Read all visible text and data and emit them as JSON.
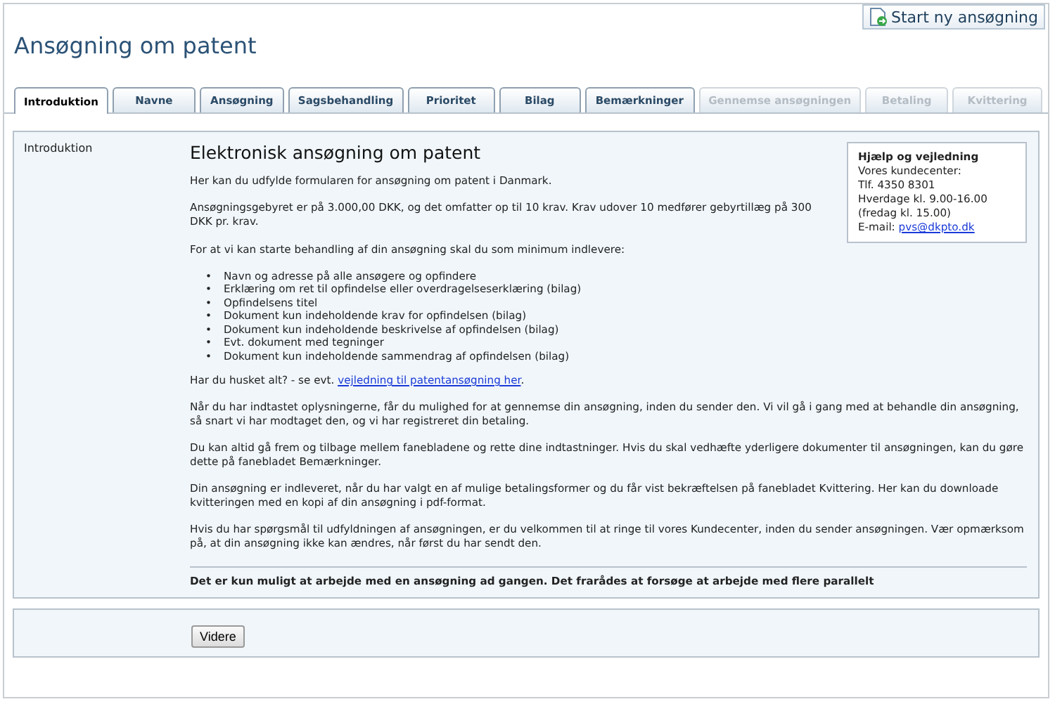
{
  "header": {
    "new_button": "Start ny ansøgning",
    "title": "Ansøgning om patent"
  },
  "tabs": [
    {
      "label": "Introduktion",
      "selected": true,
      "disabled": false
    },
    {
      "label": "Navne",
      "selected": false,
      "disabled": false
    },
    {
      "label": "Ansøgning",
      "selected": false,
      "disabled": false
    },
    {
      "label": "Sagsbehandling",
      "selected": false,
      "disabled": false
    },
    {
      "label": "Prioritet",
      "selected": false,
      "disabled": false
    },
    {
      "label": "Bilag",
      "selected": false,
      "disabled": false
    },
    {
      "label": "Bemærkninger",
      "selected": false,
      "disabled": false
    },
    {
      "label": "Gennemse ansøgningen",
      "selected": false,
      "disabled": true
    },
    {
      "label": "Betaling",
      "selected": false,
      "disabled": true
    },
    {
      "label": "Kvittering",
      "selected": false,
      "disabled": true
    }
  ],
  "section": {
    "label": "Introduktion",
    "heading": "Elektronisk ansøgning om patent",
    "help": {
      "title": "Hjælp og vejledning",
      "lines": [
        "Vores kundecenter:",
        "Tlf. 4350 8301",
        "Hverdage kl. 9.00-16.00",
        "(fredag kl. 15.00)"
      ],
      "email_label": "E-mail: ",
      "email": "pvs@dkpto.dk"
    },
    "top_blocks": [
      {
        "kind": "text",
        "text": "Her kan du udfylde formularen for ansøgning om patent i Danmark."
      },
      {
        "kind": "text",
        "text": "Ansøgningsgebyret er på 3.000,00 DKK, og det omfatter op til 10 krav. Krav udover 10 medfører gebyrtillæg på 300 DKK pr. krav."
      }
    ],
    "blocks": [
      {
        "kind": "text",
        "text": "For at vi kan starte behandling af din ansøgning skal du som minimum indlevere:"
      },
      {
        "kind": "list",
        "marker": "•",
        "items": [
          "Navn og adresse på alle ansøgere og opfindere",
          "Erklæring om ret til opfindelse eller overdragelseserklæring (bilag)",
          "Opfindelsens titel",
          "Dokument kun indeholdende krav for opfindelsen (bilag)",
          "Dokument kun indeholdende beskrivelse af opfindelsen (bilag)",
          "Evt. dokument med tegninger",
          "Dokument kun indeholdende sammendrag af opfindelsen (bilag)"
        ]
      },
      {
        "kind": "link",
        "before": "Har du husket alt? - se evt. ",
        "link": "vejledning til patentansøgning her",
        "after": "."
      },
      {
        "kind": "text",
        "text": "Når du har indtastet oplysningerne, får du mulighed for at gennemse din ansøgning, inden du sender den. Vi vil gå i gang med at behandle din ansøgning, så snart vi har modtaget den, og vi har registreret din betaling."
      },
      {
        "kind": "text",
        "text": "Du kan altid gå frem og tilbage mellem fanebladene og rette dine indtastninger. Hvis du skal vedhæfte yderligere dokumenter til ansøgningen, kan du gøre dette på fanebladet Bemærkninger."
      },
      {
        "kind": "text",
        "text": "Din ansøgning er indleveret, når du har valgt en af mulige betalingsformer og du får vist bekræftelsen på fanebladet Kvittering. Her kan du downloade kvitteringen med en kopi af din ansøgning i pdf-format."
      },
      {
        "kind": "text",
        "text": "Hvis du har spørgsmål til udfyldningen af ansøgningen, er du velkommen til at ringe til vores Kundecenter, inden du sender ansøgningen. Vær opmærksom på, at din ansøgning ikke kan ændres, når først du har sendt den."
      }
    ],
    "notice": "Det er kun muligt at arbejde med en ansøgning ad gangen. Det frarådes at forsøge at arbejde med flere parallelt"
  },
  "footer": {
    "next_button": "Videre"
  }
}
